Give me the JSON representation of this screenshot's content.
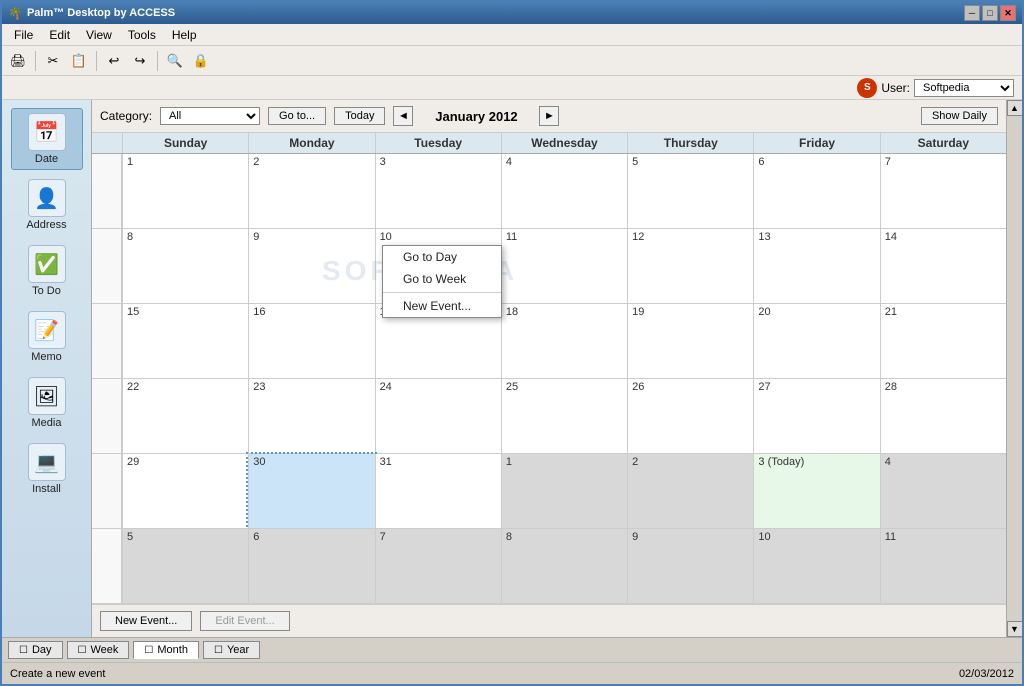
{
  "titlebar": {
    "title": "Palm™ Desktop by ACCESS",
    "icon": "🌴"
  },
  "menubar": {
    "items": [
      "File",
      "Edit",
      "View",
      "Tools",
      "Help"
    ]
  },
  "toolbar": {
    "buttons": [
      "🖨",
      "✂",
      "📋",
      "↩",
      "↪",
      "🔍",
      "🔒"
    ]
  },
  "userbar": {
    "user_label": "User:",
    "user_value": "Softpedia",
    "brand_icon": "S"
  },
  "calendar": {
    "category_label": "Category:",
    "category_value": "All",
    "goto_label": "Go to...",
    "today_label": "Today",
    "month_title": "January 2012",
    "show_daily_label": "Show Daily",
    "day_headers": [
      "Sunday",
      "Monday",
      "Tuesday",
      "Wednesday",
      "Thursday",
      "Friday",
      "Saturday"
    ],
    "weeks": [
      [
        {
          "num": "1",
          "inMonth": true,
          "isToday": false,
          "isSelected": false,
          "label": ""
        },
        {
          "num": "2",
          "inMonth": true,
          "isToday": false,
          "isSelected": false,
          "label": ""
        },
        {
          "num": "3",
          "inMonth": true,
          "isToday": false,
          "isSelected": false,
          "label": ""
        },
        {
          "num": "4",
          "inMonth": true,
          "isToday": false,
          "isSelected": false,
          "label": ""
        },
        {
          "num": "5",
          "inMonth": true,
          "isToday": false,
          "isSelected": false,
          "label": ""
        },
        {
          "num": "6",
          "inMonth": true,
          "isToday": false,
          "isSelected": false,
          "label": ""
        },
        {
          "num": "7",
          "inMonth": true,
          "isToday": false,
          "isSelected": false,
          "label": ""
        }
      ],
      [
        {
          "num": "8",
          "inMonth": true,
          "isToday": false,
          "isSelected": false,
          "label": ""
        },
        {
          "num": "9",
          "inMonth": true,
          "isToday": false,
          "isSelected": false,
          "label": ""
        },
        {
          "num": "10",
          "inMonth": true,
          "isToday": false,
          "isSelected": false,
          "label": ""
        },
        {
          "num": "11",
          "inMonth": true,
          "isToday": false,
          "isSelected": false,
          "label": ""
        },
        {
          "num": "12",
          "inMonth": true,
          "isToday": false,
          "isSelected": false,
          "label": ""
        },
        {
          "num": "13",
          "inMonth": true,
          "isToday": false,
          "isSelected": false,
          "label": ""
        },
        {
          "num": "14",
          "inMonth": true,
          "isToday": false,
          "isSelected": false,
          "label": ""
        }
      ],
      [
        {
          "num": "15",
          "inMonth": true,
          "isToday": false,
          "isSelected": false,
          "label": ""
        },
        {
          "num": "16",
          "inMonth": true,
          "isToday": false,
          "isSelected": false,
          "label": ""
        },
        {
          "num": "17",
          "inMonth": true,
          "isToday": false,
          "isSelected": false,
          "label": ""
        },
        {
          "num": "18",
          "inMonth": true,
          "isToday": false,
          "isSelected": false,
          "label": ""
        },
        {
          "num": "19",
          "inMonth": true,
          "isToday": false,
          "isSelected": false,
          "label": ""
        },
        {
          "num": "20",
          "inMonth": true,
          "isToday": false,
          "isSelected": false,
          "label": ""
        },
        {
          "num": "21",
          "inMonth": true,
          "isToday": false,
          "isSelected": false,
          "label": ""
        }
      ],
      [
        {
          "num": "22",
          "inMonth": true,
          "isToday": false,
          "isSelected": false,
          "label": ""
        },
        {
          "num": "23",
          "inMonth": true,
          "isToday": false,
          "isSelected": false,
          "label": ""
        },
        {
          "num": "24",
          "inMonth": true,
          "isToday": false,
          "isSelected": false,
          "label": ""
        },
        {
          "num": "25",
          "inMonth": true,
          "isToday": false,
          "isSelected": false,
          "label": ""
        },
        {
          "num": "26",
          "inMonth": true,
          "isToday": false,
          "isSelected": false,
          "label": ""
        },
        {
          "num": "27",
          "inMonth": true,
          "isToday": false,
          "isSelected": false,
          "label": ""
        },
        {
          "num": "28",
          "inMonth": true,
          "isToday": false,
          "isSelected": false,
          "label": ""
        }
      ],
      [
        {
          "num": "29",
          "inMonth": true,
          "isToday": false,
          "isSelected": false,
          "label": ""
        },
        {
          "num": "30",
          "inMonth": true,
          "isToday": false,
          "isSelected": true,
          "label": ""
        },
        {
          "num": "31",
          "inMonth": true,
          "isToday": false,
          "isSelected": false,
          "label": ""
        },
        {
          "num": "1",
          "inMonth": false,
          "isToday": false,
          "isSelected": false,
          "label": ""
        },
        {
          "num": "2",
          "inMonth": false,
          "isToday": false,
          "isSelected": false,
          "label": ""
        },
        {
          "num": "3 (Today)",
          "inMonth": false,
          "isToday": true,
          "isSelected": false,
          "label": ""
        },
        {
          "num": "4",
          "inMonth": false,
          "isToday": false,
          "isSelected": false,
          "label": ""
        }
      ],
      [
        {
          "num": "5",
          "inMonth": false,
          "isToday": false,
          "isSelected": false,
          "label": ""
        },
        {
          "num": "6",
          "inMonth": false,
          "isToday": false,
          "isSelected": false,
          "label": ""
        },
        {
          "num": "7",
          "inMonth": false,
          "isToday": false,
          "isSelected": false,
          "label": ""
        },
        {
          "num": "8",
          "inMonth": false,
          "isToday": false,
          "isSelected": false,
          "label": ""
        },
        {
          "num": "9",
          "inMonth": false,
          "isToday": false,
          "isSelected": false,
          "label": ""
        },
        {
          "num": "10",
          "inMonth": false,
          "isToday": false,
          "isSelected": false,
          "label": ""
        },
        {
          "num": "11",
          "inMonth": false,
          "isToday": false,
          "isSelected": false,
          "label": ""
        }
      ]
    ]
  },
  "context_menu": {
    "items": [
      "Go to Day",
      "Go to Week",
      "New Event..."
    ],
    "separator_after": 1
  },
  "bottom_buttons": {
    "new_event": "New Event...",
    "edit_event": "Edit Event..."
  },
  "view_tabs": [
    {
      "label": "Day",
      "icon": "☐",
      "active": false
    },
    {
      "label": "Week",
      "icon": "☐",
      "active": false
    },
    {
      "label": "Month",
      "icon": "☐",
      "active": true
    },
    {
      "label": "Year",
      "icon": "☐",
      "active": false
    }
  ],
  "statusbar": {
    "status_text": "Create a new event",
    "date_text": "02/03/2012"
  },
  "sidebar": {
    "items": [
      {
        "label": "Date",
        "icon": "📅",
        "active": true
      },
      {
        "label": "Address",
        "icon": "👤",
        "active": false
      },
      {
        "label": "To Do",
        "icon": "✓",
        "active": false
      },
      {
        "label": "Memo",
        "icon": "📝",
        "active": false
      },
      {
        "label": "Media",
        "icon": "🖼",
        "active": false
      },
      {
        "label": "Install",
        "icon": "💻",
        "active": false
      }
    ]
  },
  "watermark": "SOFTPEDIA"
}
